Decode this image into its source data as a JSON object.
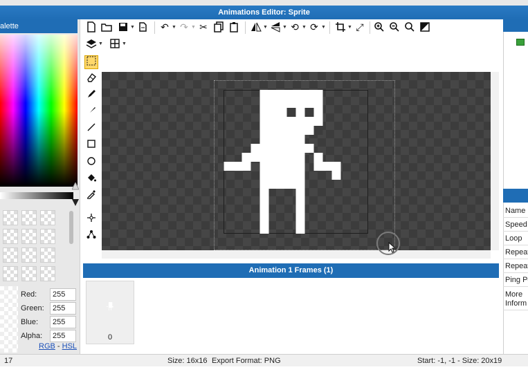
{
  "window": {
    "title": "Animations Editor: Sprite"
  },
  "palette": {
    "header": "alette",
    "fields": [
      {
        "label": "Red:",
        "value": "255"
      },
      {
        "label": "Green:",
        "value": "255"
      },
      {
        "label": "Blue:",
        "value": "255"
      },
      {
        "label": "Alpha:",
        "value": "255"
      }
    ],
    "mode_rgb": "RGB",
    "mode_sep": " - ",
    "mode_hsl": "HSL"
  },
  "toolbar": {
    "row1": [
      "new-file-icon",
      "open-folder-icon",
      "save-icon",
      "export-icon",
      "undo-icon",
      "redo-icon",
      "cut-icon",
      "copy-icon",
      "paste-icon",
      "flip-horizontal-icon",
      "flip-vertical-icon",
      "rotate-left-icon",
      "rotate-right-icon",
      "crop-icon",
      "resize-icon",
      "zoom-in-icon",
      "zoom-out-icon",
      "zoom-reset-icon",
      "fill-black-icon"
    ],
    "row2": [
      "layers-icon",
      "grid-icon"
    ]
  },
  "tools": [
    "select-rect-icon",
    "eraser-icon",
    "pencil-icon",
    "brush-icon",
    "line-icon",
    "rectangle-icon",
    "ellipse-icon",
    "fill-bucket-icon",
    "eyedropper-icon",
    "move-anchor-icon",
    "pivot-icon"
  ],
  "frames": {
    "header": "Animation 1 Frames (1)",
    "items": [
      {
        "index": "0"
      }
    ]
  },
  "properties": {
    "rows": [
      "Name",
      "Speed",
      "Loop",
      "Repeat",
      "Repeat",
      "Ping Po",
      "More Inform"
    ]
  },
  "status": {
    "left": "17",
    "size": "Size: 16x16",
    "export": "Export Format: PNG",
    "right": "Start: -1, -1 - Size: 20x19"
  },
  "colors": {
    "accent": "#1f6db5",
    "canvas_dark": "#3c3c3c",
    "selected_tool": "#ffd86b"
  }
}
